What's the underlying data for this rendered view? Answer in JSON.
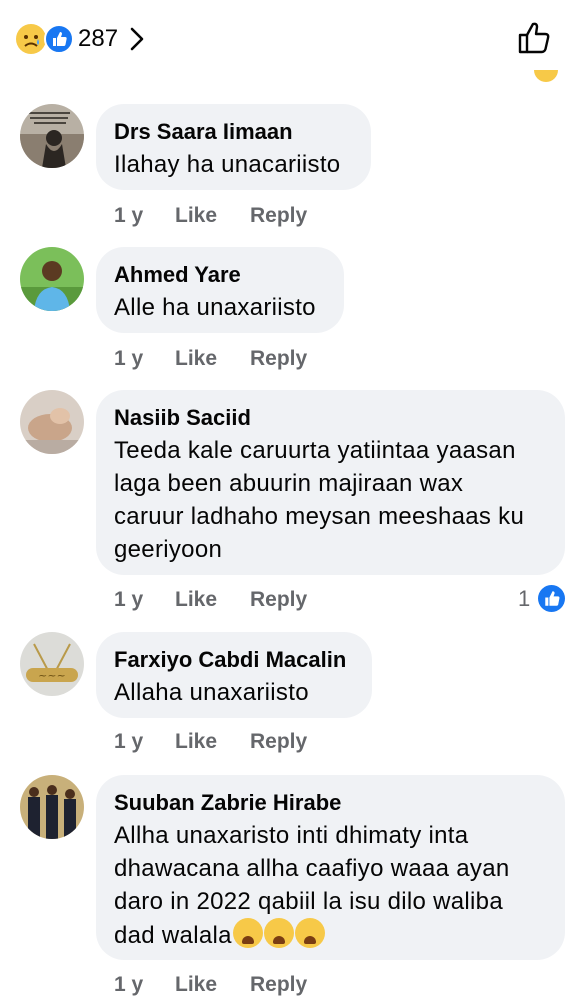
{
  "header": {
    "reaction_count": "287"
  },
  "comments": [
    {
      "author": "Drs Saara Iimaan",
      "text": "Ilahay ha unacariisto",
      "time": "1 y",
      "like_label": "Like",
      "reply_label": "Reply"
    },
    {
      "author": "Ahmed Yare",
      "text": "Alle ha unaxariisto",
      "time": "1 y",
      "like_label": "Like",
      "reply_label": "Reply"
    },
    {
      "author": "Nasiib Saciid",
      "text_lines": [
        "Teeda kale caruurta yatiintaa yaasan",
        "laga been abuurin majiraan wax",
        "caruur ladhaho meysan meeshaas ku",
        "geeriyoon"
      ],
      "time": "1 y",
      "like_label": "Like",
      "reply_label": "Reply",
      "reaction_count": "1"
    },
    {
      "author": "Farxiyo Cabdi Macalin",
      "text": "Allaha unaxariisto",
      "time": "1 y",
      "like_label": "Like",
      "reply_label": "Reply"
    },
    {
      "author": "Suuban Zabrie Hirabe",
      "text_lines": [
        "Allha unaxaristo inti dhimaty inta",
        "dhawacana allha caafiyo waaa ayan",
        "daro in 2022 qabiil la isu dilo waliba",
        "dad walala"
      ],
      "time": "1 y",
      "like_label": "Like",
      "reply_label": "Reply"
    }
  ]
}
